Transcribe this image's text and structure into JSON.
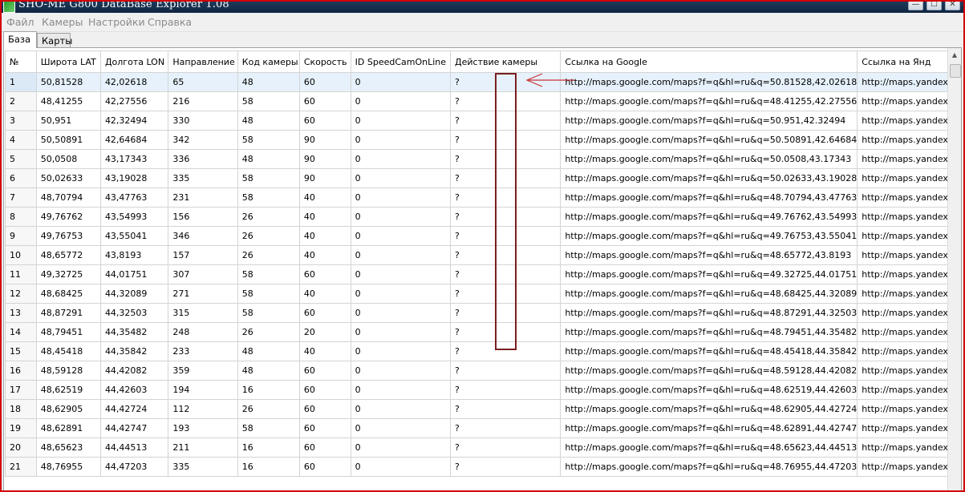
{
  "window": {
    "title": "SHO-ME G800 DataBase Explorer 1.08"
  },
  "window_controls": {
    "minimize": "—",
    "maximize": "☐",
    "close": "✕"
  },
  "menu": [
    "Файл",
    "Камеры",
    "Настройки",
    "Справка"
  ],
  "tabs": [
    "База",
    "Карты"
  ],
  "table": {
    "columns": [
      "№",
      "Широта LAT",
      "Долгота LON",
      "Направление",
      "Код камеры",
      "Скорость",
      "ID SpeedCamOnLine",
      "Действие камеры",
      "Ссылка на Google",
      "Ссылка на Янд"
    ],
    "rows": [
      [
        "1",
        "50,81528",
        "42,02618",
        "65",
        "48",
        "60",
        "0",
        "?",
        "http://maps.google.com/maps?f=q&hl=ru&q=50.81528,42.02618",
        "http://maps.yandex.ru"
      ],
      [
        "2",
        "48,41255",
        "42,27556",
        "216",
        "58",
        "60",
        "0",
        "?",
        "http://maps.google.com/maps?f=q&hl=ru&q=48.41255,42.27556",
        "http://maps.yandex.ru"
      ],
      [
        "3",
        "50,951",
        "42,32494",
        "330",
        "48",
        "60",
        "0",
        "?",
        "http://maps.google.com/maps?f=q&hl=ru&q=50.951,42.32494",
        "http://maps.yandex.ru"
      ],
      [
        "4",
        "50,50891",
        "42,64684",
        "342",
        "58",
        "90",
        "0",
        "?",
        "http://maps.google.com/maps?f=q&hl=ru&q=50.50891,42.64684",
        "http://maps.yandex.ru"
      ],
      [
        "5",
        "50,0508",
        "43,17343",
        "336",
        "48",
        "90",
        "0",
        "?",
        "http://maps.google.com/maps?f=q&hl=ru&q=50.0508,43.17343",
        "http://maps.yandex.ru"
      ],
      [
        "6",
        "50,02633",
        "43,19028",
        "335",
        "58",
        "90",
        "0",
        "?",
        "http://maps.google.com/maps?f=q&hl=ru&q=50.02633,43.19028",
        "http://maps.yandex.ru"
      ],
      [
        "7",
        "48,70794",
        "43,47763",
        "231",
        "58",
        "40",
        "0",
        "?",
        "http://maps.google.com/maps?f=q&hl=ru&q=48.70794,43.47763",
        "http://maps.yandex.ru"
      ],
      [
        "8",
        "49,76762",
        "43,54993",
        "156",
        "26",
        "40",
        "0",
        "?",
        "http://maps.google.com/maps?f=q&hl=ru&q=49.76762,43.54993",
        "http://maps.yandex.ru"
      ],
      [
        "9",
        "49,76753",
        "43,55041",
        "346",
        "26",
        "40",
        "0",
        "?",
        "http://maps.google.com/maps?f=q&hl=ru&q=49.76753,43.55041",
        "http://maps.yandex.ru"
      ],
      [
        "10",
        "48,65772",
        "43,8193",
        "157",
        "26",
        "40",
        "0",
        "?",
        "http://maps.google.com/maps?f=q&hl=ru&q=48.65772,43.8193",
        "http://maps.yandex.ru"
      ],
      [
        "11",
        "49,32725",
        "44,01751",
        "307",
        "58",
        "60",
        "0",
        "?",
        "http://maps.google.com/maps?f=q&hl=ru&q=49.32725,44.01751",
        "http://maps.yandex.ru"
      ],
      [
        "12",
        "48,68425",
        "44,32089",
        "271",
        "58",
        "40",
        "0",
        "?",
        "http://maps.google.com/maps?f=q&hl=ru&q=48.68425,44.32089",
        "http://maps.yandex.ru"
      ],
      [
        "13",
        "48,87291",
        "44,32503",
        "315",
        "58",
        "60",
        "0",
        "?",
        "http://maps.google.com/maps?f=q&hl=ru&q=48.87291,44.32503",
        "http://maps.yandex.ru"
      ],
      [
        "14",
        "48,79451",
        "44,35482",
        "248",
        "26",
        "20",
        "0",
        "?",
        "http://maps.google.com/maps?f=q&hl=ru&q=48.79451,44.35482",
        "http://maps.yandex.ru"
      ],
      [
        "15",
        "48,45418",
        "44,35842",
        "233",
        "48",
        "40",
        "0",
        "?",
        "http://maps.google.com/maps?f=q&hl=ru&q=48.45418,44.35842",
        "http://maps.yandex.ru"
      ],
      [
        "16",
        "48,59128",
        "44,42082",
        "359",
        "48",
        "60",
        "0",
        "?",
        "http://maps.google.com/maps?f=q&hl=ru&q=48.59128,44.42082",
        "http://maps.yandex.ru"
      ],
      [
        "17",
        "48,62519",
        "44,42603",
        "194",
        "16",
        "60",
        "0",
        "?",
        "http://maps.google.com/maps?f=q&hl=ru&q=48.62519,44.42603",
        "http://maps.yandex.ru"
      ],
      [
        "18",
        "48,62905",
        "44,42724",
        "112",
        "26",
        "60",
        "0",
        "?",
        "http://maps.google.com/maps?f=q&hl=ru&q=48.62905,44.42724",
        "http://maps.yandex.ru"
      ],
      [
        "19",
        "48,62891",
        "44,42747",
        "193",
        "58",
        "60",
        "0",
        "?",
        "http://maps.google.com/maps?f=q&hl=ru&q=48.62891,44.42747",
        "http://maps.yandex.ru"
      ],
      [
        "20",
        "48,65623",
        "44,44513",
        "211",
        "16",
        "60",
        "0",
        "?",
        "http://maps.google.com/maps?f=q&hl=ru&q=48.65623,44.44513",
        "http://maps.yandex.ru"
      ],
      [
        "21",
        "48,76955",
        "44,47203",
        "335",
        "16",
        "60",
        "0",
        "?",
        "http://maps.google.com/maps?f=q&hl=ru&q=48.76955,44.47203",
        "http://maps.yandex.ru"
      ]
    ]
  },
  "colors": {
    "frame_border": "#d40000",
    "annotation": "#7a1f1f",
    "selected_row": "#e6f1fb",
    "titlebar": "#0f2540"
  }
}
